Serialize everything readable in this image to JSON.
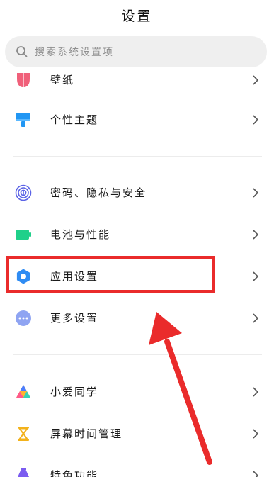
{
  "header": {
    "title": "设置"
  },
  "search": {
    "placeholder": "搜索系统设置项"
  },
  "items": [
    {
      "label": "壁纸",
      "icon": "wallpaper-icon"
    },
    {
      "label": "个性主题",
      "icon": "theme-brush-icon"
    },
    {
      "label": "密码、隐私与安全",
      "icon": "fingerprint-icon"
    },
    {
      "label": "电池与性能",
      "icon": "battery-icon"
    },
    {
      "label": "应用设置",
      "icon": "gear-icon"
    },
    {
      "label": "更多设置",
      "icon": "more-dots-icon"
    },
    {
      "label": "小爱同学",
      "icon": "xiaoai-icon"
    },
    {
      "label": "屏幕时间管理",
      "icon": "hourglass-icon"
    },
    {
      "label": "特色功能",
      "icon": "special-features-icon"
    }
  ],
  "colors": {
    "highlight": "#ea2b2b",
    "theme_icon": "#2196f3",
    "fingerprint_icon": "#5b63e6",
    "battery_icon": "#1fd08a",
    "gear_icon": "#2f8cf3",
    "more_icon": "#8fa4f2",
    "hourglass_icon": "#f3b21b",
    "wallpaper_icon": "#f0607a"
  }
}
